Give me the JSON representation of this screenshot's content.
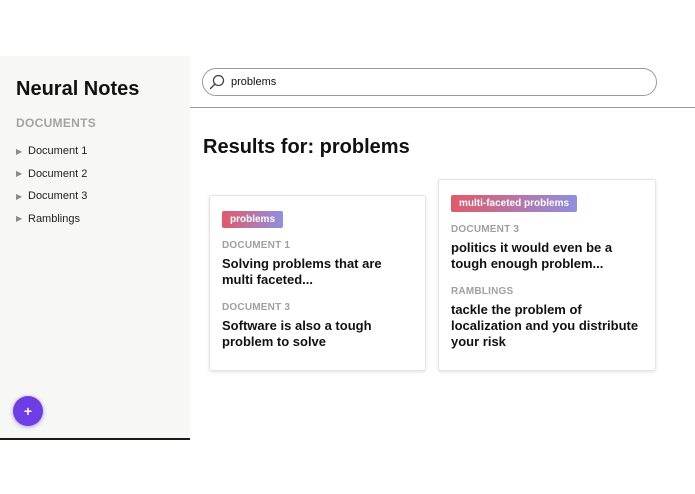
{
  "sidebar": {
    "brand": "Neural Notes",
    "section_title": "DOCUMENTS",
    "items": [
      {
        "label": "Document 1"
      },
      {
        "label": "Document 2"
      },
      {
        "label": "Document 3"
      },
      {
        "label": "Ramblings"
      }
    ],
    "add_button_label": "+"
  },
  "search": {
    "value": "problems",
    "icon": "search-icon"
  },
  "results": {
    "heading": "Results for: problems",
    "groups": [
      {
        "tag": "problems",
        "matches": [
          {
            "document": "DOCUMENT 1",
            "text": "Solving problems that are multi faceted..."
          },
          {
            "document": "DOCUMENT 3",
            "text": "Software is also a tough problem to solve"
          }
        ]
      },
      {
        "tag": "multi-faceted problems",
        "matches": [
          {
            "document": "DOCUMENT 3",
            "text": "politics it would even be a tough enough problem..."
          },
          {
            "document": "RAMBLINGS",
            "text": "tackle the problem of localization and you distribute your risk"
          }
        ]
      }
    ]
  },
  "colors": {
    "accent": "#6f3de6",
    "tag_gradient_start": "#e15a6a",
    "tag_gradient_end": "#8f8fe0",
    "sidebar_bg": "#f7f7f5"
  }
}
